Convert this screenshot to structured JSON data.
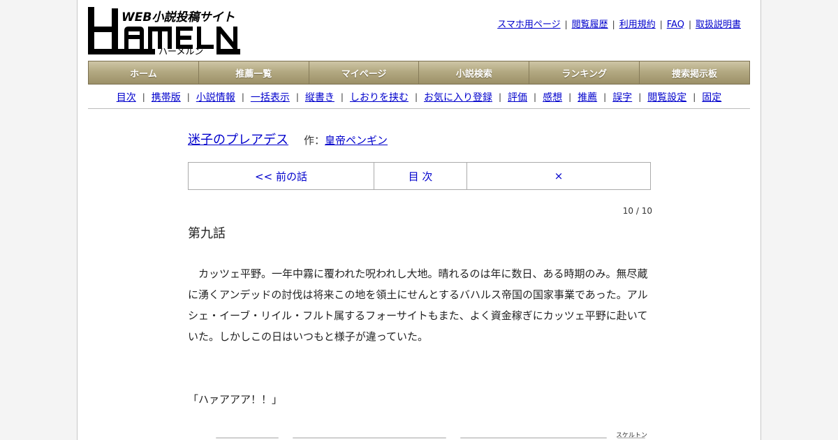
{
  "logo": {
    "brand": "HAMELN",
    "tagline": "WEB小説投稿サイト",
    "kana": "ハーメルン"
  },
  "top_links": [
    "スマホ用ページ",
    "閲覧履歴",
    "利用規約",
    "FAQ",
    "取扱説明書"
  ],
  "main_nav": [
    "ホーム",
    "推薦一覧",
    "マイページ",
    "小説検索",
    "ランキング",
    "捜索掲示板"
  ],
  "sub_nav": [
    "目次",
    "携帯版",
    "小説情報",
    "一括表示",
    "縦書き",
    "しおりを挟む",
    "お気に入り登録",
    "評価",
    "感想",
    "推薦",
    "誤字",
    "閲覧設定",
    "固定"
  ],
  "novel": {
    "title": "迷子のプレアデス",
    "author_prefix": "作：",
    "author": "皇帝ペンギン"
  },
  "pager": {
    "prev": "<< 前の話",
    "toc": "目 次",
    "close": "×"
  },
  "page_count": "10 / 10",
  "chapter_title": "第九話",
  "body_text": "　カッツェ平野。一年中霧に覆われた呪われし大地。晴れるのは年に数日、ある時期のみ。無尽蔵に湧くアンデッドの討伐は将来この地を領土にせんとするバハルス帝国の国家事業であった。アルシェ・イーブ・リイル・フルト属するフォーサイトもまた、よく資金稼ぎにカッツェ平野に赴いていた。しかしこの日はいつもと様子が違っていた。",
  "dialogue": "「ハァアアア！！」",
  "ruby_hint": "スケルトン"
}
